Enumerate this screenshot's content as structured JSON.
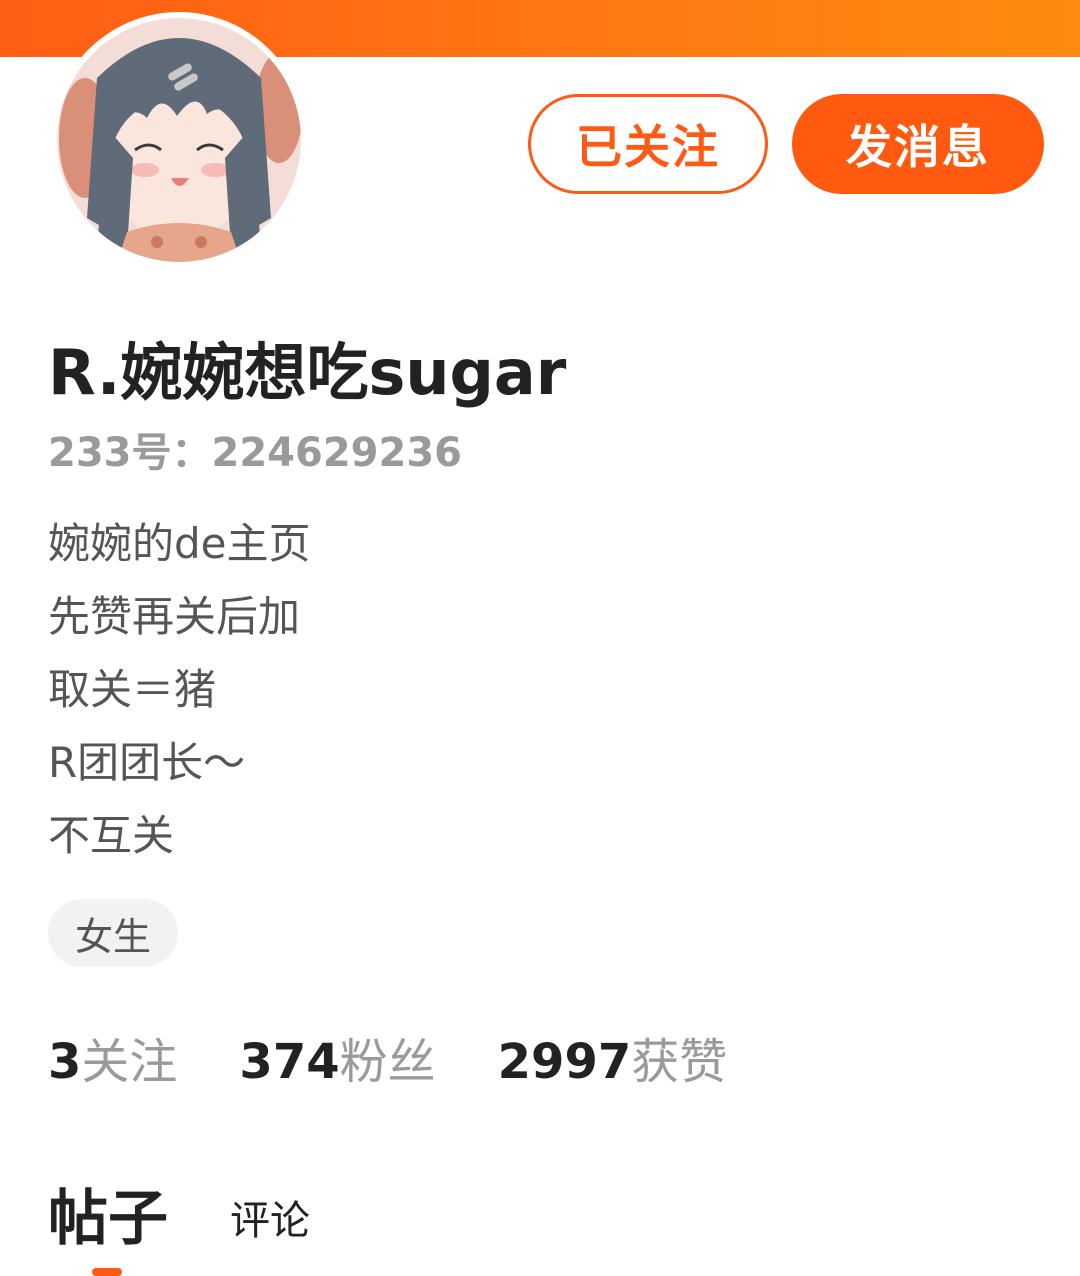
{
  "colors": {
    "accent": "#ff5a14",
    "banner": "#ff7a12",
    "text_primary": "#222222",
    "text_secondary": "#9a9a9a"
  },
  "header": {
    "avatar_icon": "anime-girl-avatar"
  },
  "actions": {
    "follow_label": "已关注",
    "message_label": "发消息"
  },
  "profile": {
    "username": "R.婉婉想吃sugar",
    "uid": "233号：224629236",
    "bio": [
      "婉婉的de主页",
      "先赞再关后加",
      "取关＝猪",
      "R团团长～",
      "不互关"
    ],
    "gender_tag": "女生"
  },
  "stats": {
    "following_count": "3",
    "following_label": "关注",
    "fans_count": "374",
    "fans_label": "粉丝",
    "likes_count": "2997",
    "likes_label": "获赞"
  },
  "tabs": {
    "posts": "帖子",
    "comments": "评论",
    "active": "帖子"
  }
}
